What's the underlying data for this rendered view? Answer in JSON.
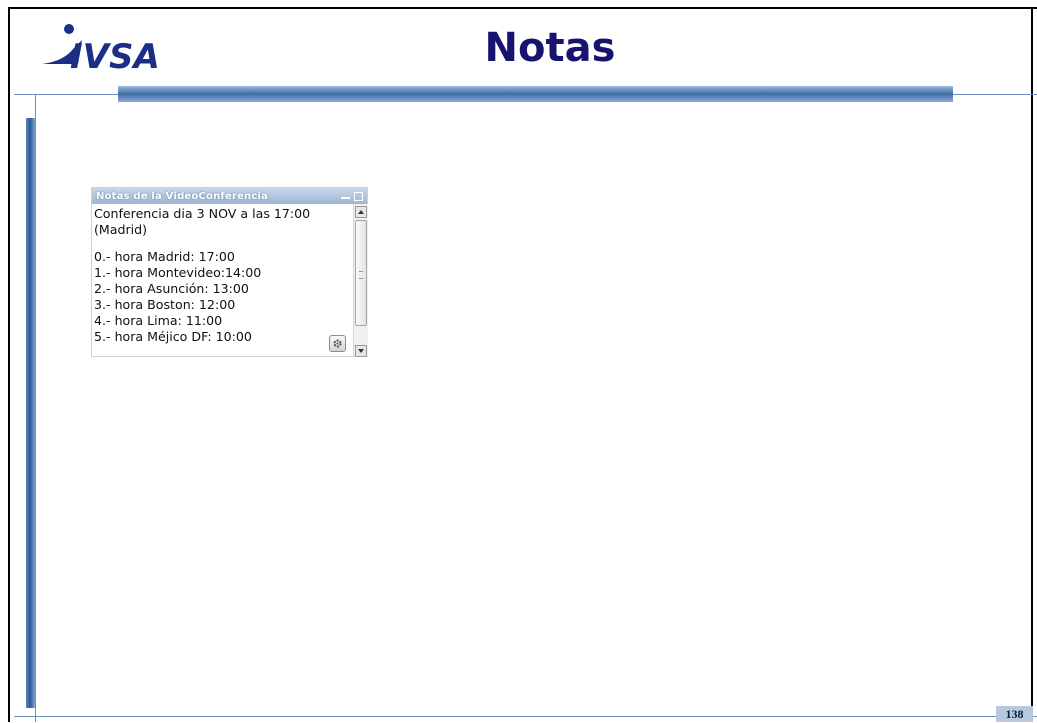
{
  "slide": {
    "title": "Notas",
    "logo_text": "IVSA",
    "page_number": "138"
  },
  "notes_panel": {
    "title": "Notas de la VideoConferencia",
    "lines": [
      "Conferencia dia 3 NOV a las 17:00",
      "(Madrid)",
      "",
      "0.- hora Madrid: 17:00",
      "1.- hora Montevideo:14:00",
      "2.- hora Asunción: 13:00",
      "3.- hora Boston: 12:00",
      "4.- hora Lima: 11:00",
      "5.- hora Méjico DF: 10:00"
    ]
  },
  "colors": {
    "title": "#17146f",
    "logo": "#1d2e86",
    "accent_bar": "#3f6ea8"
  },
  "icons": [
    "minimize-icon",
    "maximize-icon",
    "scroll-up-icon",
    "scroll-down-icon",
    "gear-icon"
  ]
}
